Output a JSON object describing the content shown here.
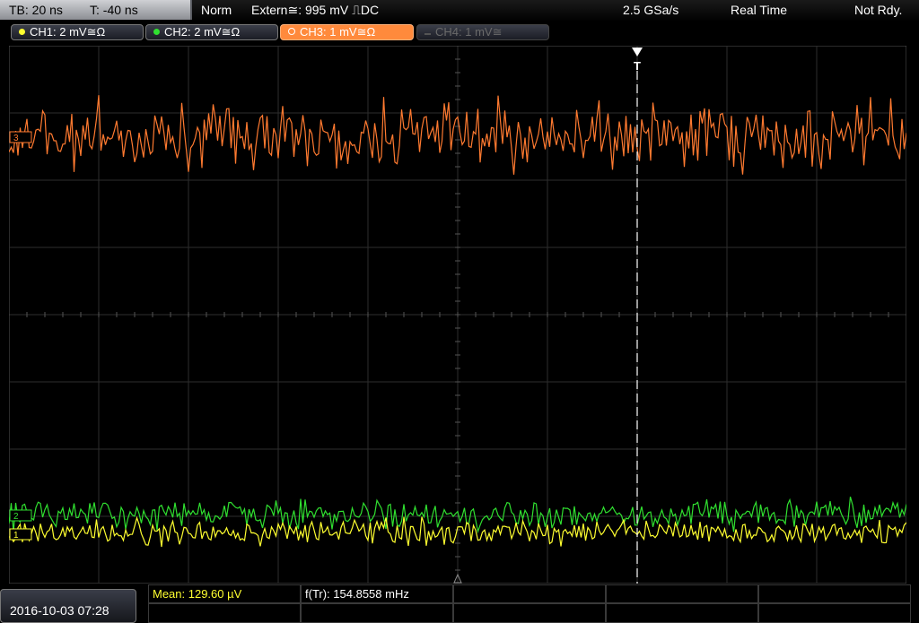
{
  "header": {
    "timebase": "TB: 20 ns",
    "trigger_time": "T: -40 ns",
    "acq_mode": "Norm",
    "trigger_source": "Extern≅: 995 mV ⎍DC",
    "sample_rate": "2.5 GSa/s",
    "acq_type": "Real Time",
    "status": "Not Rdy."
  },
  "channels": [
    {
      "label": "CH1: 2 mV≅Ω",
      "color": "#ffff30",
      "state": "on"
    },
    {
      "label": "CH2: 2 mV≅Ω",
      "color": "#30e030",
      "state": "on"
    },
    {
      "label": "CH3: 1 mV≅Ω",
      "color": "#ff8a3c",
      "state": "selected"
    },
    {
      "label": "CH4: 1 mV≅",
      "color": "#606060",
      "state": "off"
    }
  ],
  "markers": {
    "ch1": "1",
    "ch2": "2",
    "ch3": "3",
    "trigger": "T"
  },
  "footer": {
    "datetime": "2016-10-03 07:28",
    "mean": "Mean: 129.60 µV",
    "freq": "f(Tr): 154.8558 mHz"
  },
  "colors": {
    "ch1": "#ffff30",
    "ch2": "#30e030",
    "ch3": "#ff7a30",
    "grid": "#2e2e2e",
    "screen_bg": "#000000"
  }
}
